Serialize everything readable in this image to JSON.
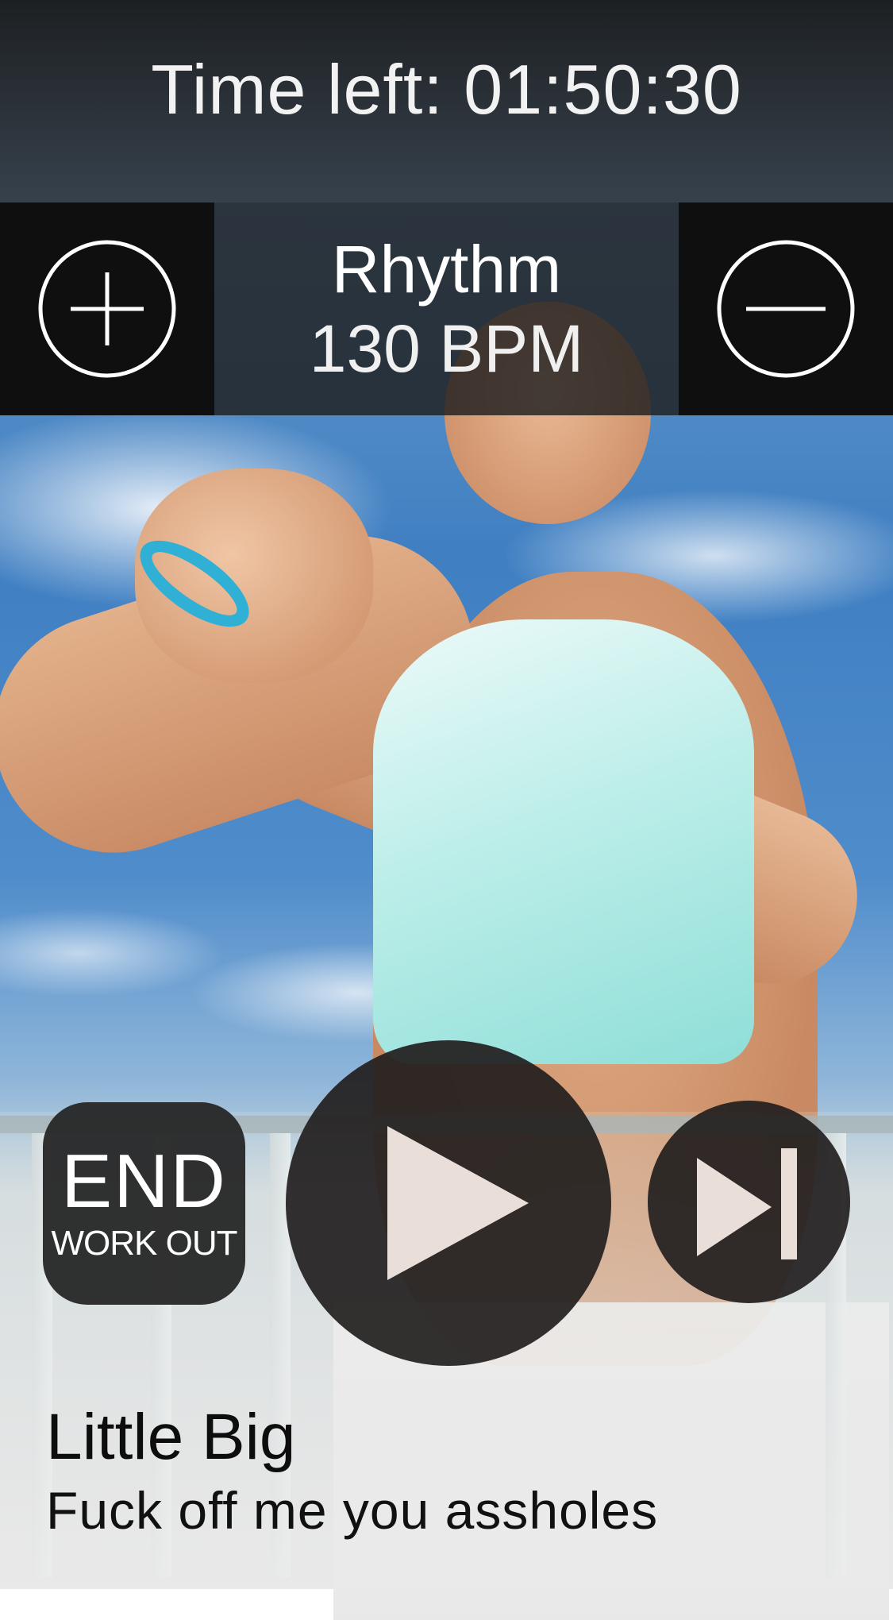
{
  "timer": {
    "label": "Time left: 01:50:30"
  },
  "rhythm": {
    "label": "Rhythm",
    "value": "130 BPM",
    "increase_icon": "plus-circle-icon",
    "decrease_icon": "minus-circle-icon"
  },
  "controls": {
    "end_big": "END",
    "end_small": "WORK OUT",
    "play_icon": "play-icon",
    "next_icon": "skip-next-icon"
  },
  "track": {
    "artist": "Little Big",
    "title": "Fuck off me you assholes"
  },
  "colors": {
    "overlay_dark": "#141414",
    "button_dark": "#221e1e",
    "icon_light": "#f3e8e1",
    "wristband": "#2fb0d4"
  }
}
